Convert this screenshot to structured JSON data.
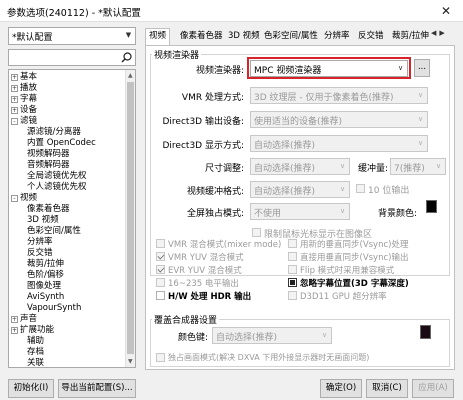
{
  "window": {
    "title": "参数选项(240112) - *默认配置",
    "close_glyph": "✕"
  },
  "profile": {
    "value": "*默认配置"
  },
  "search": {
    "placeholder": "",
    "icon": "search-icon"
  },
  "tree": {
    "items": [
      {
        "label": "基本",
        "exp": "+"
      },
      {
        "label": "播放",
        "exp": "+"
      },
      {
        "label": "字幕",
        "exp": "+"
      },
      {
        "label": "设备",
        "exp": "+"
      },
      {
        "label": "滤镜",
        "exp": "-"
      },
      {
        "label": "源滤镜/分离器"
      },
      {
        "label": "内置 OpenCodec"
      },
      {
        "label": "视频解码器"
      },
      {
        "label": "音频解码器"
      },
      {
        "label": "全局滤镜优先权"
      },
      {
        "label": "个人滤镜优先权"
      },
      {
        "label": "视频",
        "exp": "-"
      },
      {
        "label": "像素着色器"
      },
      {
        "label": "3D 视频"
      },
      {
        "label": "色彩空间/属性"
      },
      {
        "label": "分辨率"
      },
      {
        "label": "反交错"
      },
      {
        "label": "裁剪/拉伸"
      },
      {
        "label": "色阶/偏移"
      },
      {
        "label": "图像处理"
      },
      {
        "label": "AviSynth"
      },
      {
        "label": "VapourSynth"
      },
      {
        "label": "声音",
        "exp": "+"
      },
      {
        "label": "扩展功能",
        "exp": "+"
      },
      {
        "label": "辅助"
      },
      {
        "label": "存档"
      },
      {
        "label": "关联"
      }
    ]
  },
  "tabs": [
    "视频",
    "像素着色器",
    "3D 视频",
    "色彩空间/属性",
    "分辨率",
    "反交错",
    "裁剪/拉伸"
  ],
  "renderer_group": {
    "title": "视频渲染器",
    "renderer_label": "视频渲染器:",
    "renderer_value": "MPC 视频渲染器",
    "renderer_more": "...",
    "vmr_mode_label": "VMR 处理方式:",
    "vmr_mode_value": "3D 纹理层 - 仅用于像素着色(推荐)",
    "d3d_output_label": "Direct3D 输出设备:",
    "d3d_output_value": "使用适当的设备(推荐)",
    "d3d_display_label": "Direct3D 显示方式:",
    "d3d_display_value": "自动选择(推荐)",
    "resize_label": "尺寸调整:",
    "resize_value": "自动选择(推荐)",
    "buffer_label": "缓冲量:",
    "buffer_value": "7(推荐)",
    "buffer_format_label": "视频缓冲格式:",
    "buffer_format_value": "自动选择(推荐)",
    "tenbit_label": "10 位输出",
    "fullscreen_label": "全屏独占模式:",
    "fullscreen_value": "不使用",
    "bg_color_label": "背景颜色:",
    "restrict_cursor_label": "限制鼠标光标显示在图像区"
  },
  "checkboxes": [
    {
      "label": "VMR 混合模式(mixer mode)",
      "state": "off",
      "disabled": true
    },
    {
      "label": "用新的垂直同步(Vsync)处理",
      "state": "off",
      "disabled": true
    },
    {
      "label": "VMR YUV 混合模式",
      "state": "checked",
      "disabled": true
    },
    {
      "label": "直接用垂直同步(Vsync)输出",
      "state": "off",
      "disabled": true
    },
    {
      "label": "EVR YUV 混合模式",
      "state": "checked",
      "disabled": true
    },
    {
      "label": "Flip 模式时采用兼容模式",
      "state": "off",
      "disabled": true
    },
    {
      "label": "16~235 电平输出",
      "state": "off",
      "disabled": true
    },
    {
      "label": "忽略字幕位置(3D 字幕深度)",
      "state": "filled",
      "disabled": false
    },
    {
      "label": "H/W 处理 HDR 输出",
      "state": "off",
      "disabled": false
    },
    {
      "label": "D3D11 GPU 超分辨率",
      "state": "off",
      "disabled": true
    }
  ],
  "overlay_group": {
    "title": "覆盖合成器设置",
    "color_key_label": "颜色键:",
    "color_key_value": "自动选择(推荐)",
    "independent_label": "独占画面模式(解决 DXVA 下用外接显示器时无画面问题)"
  },
  "buttons": {
    "init": "初始化(I)",
    "export": "导出当前配置(S)...",
    "ok": "确定(O)",
    "cancel": "取消(C)",
    "apply": "应用(A)"
  },
  "colors": {
    "highlight": "#d9232a",
    "bg_color": "#000000",
    "color_key": "#1a0a14"
  }
}
